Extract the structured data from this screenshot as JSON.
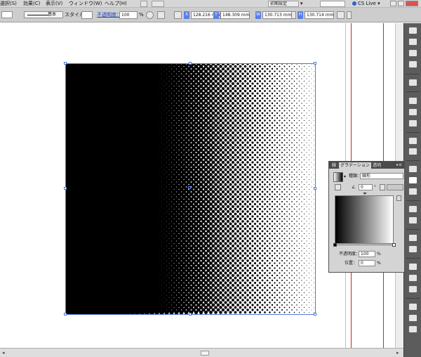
{
  "menubar": {
    "items": [
      "選択(S)",
      "効果(C)",
      "表示(V)",
      "ウィンドウ(W)",
      "ヘルプ(H)"
    ],
    "bridge_icon": "bridge-icon",
    "arrange_icon": "arrange-documents-icon",
    "workspace": "初期設定",
    "cs_live": "CS Live"
  },
  "control_bar": {
    "stroke_style": "基本",
    "style_label": "スタイル：",
    "opacity_label": "不透明度：",
    "opacity_value": "100",
    "opacity_unit": "%",
    "x_label": "X",
    "x_value": "128.216 mm",
    "y_label": "Y",
    "y_value": "148.309 mm",
    "w_label": "W",
    "w_value": "130.713 mm",
    "h_label": "H",
    "h_value": "130.714 mm"
  },
  "gradient_panel": {
    "tabs": [
      "線",
      "グラデーション",
      "透明"
    ],
    "active_tab": 1,
    "type_label": "種類：",
    "type_value": "線形",
    "angle_value": "0",
    "angle_unit": "°",
    "opacity_label": "不透明度：",
    "opacity_value": "100",
    "opacity_unit": "%",
    "location_label": "位置：",
    "location_value": "0",
    "location_unit": "%",
    "gradient_start_color": "#000000",
    "gradient_end_color": "#ffffff"
  },
  "canvas": {
    "artwork": "halftone-dot-gradient",
    "selection_color": "#4f79e0",
    "guide_color": "#d72222"
  }
}
